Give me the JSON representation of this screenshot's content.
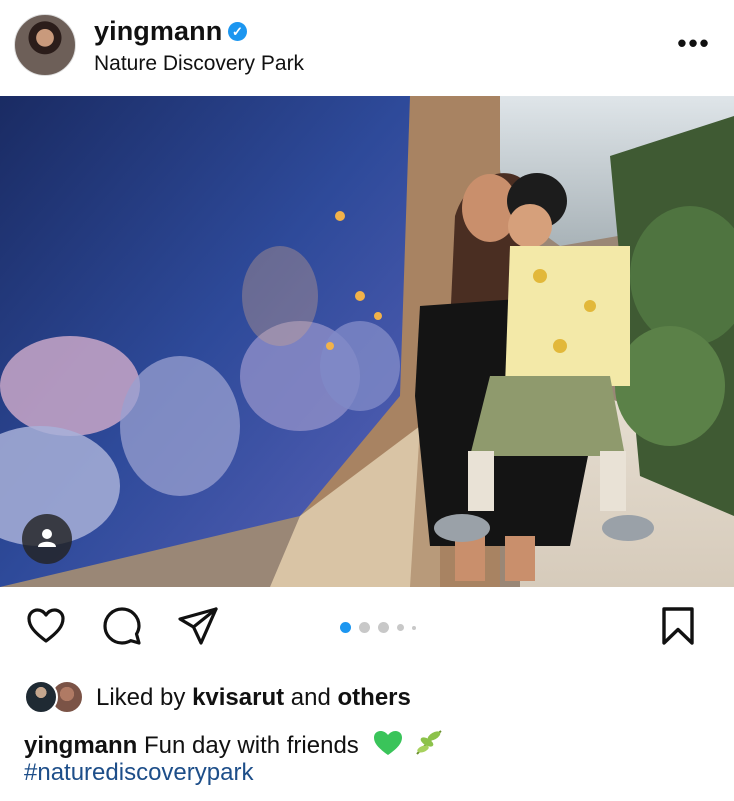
{
  "post": {
    "username": "yingmann",
    "location": "Nature Discovery Park",
    "more_label": "•••",
    "verified_mark": "✓"
  },
  "carousel": {
    "current": 1,
    "total": 5
  },
  "likes": {
    "prefix": "Liked by",
    "user": "kvisarut",
    "middle": "and",
    "others": "others"
  },
  "caption": {
    "username": "yingmann",
    "text": "Fun day with friends",
    "hashtag": "#naturediscoverypark"
  },
  "colors": {
    "accent": "#1c96f0",
    "hashtag": "#1d4e89",
    "heart_emoji": "#3ac45a"
  },
  "icons": [
    "heart-icon",
    "comment-icon",
    "share-icon",
    "bookmark-icon",
    "user-tag-icon",
    "verified-icon",
    "more-icon"
  ]
}
